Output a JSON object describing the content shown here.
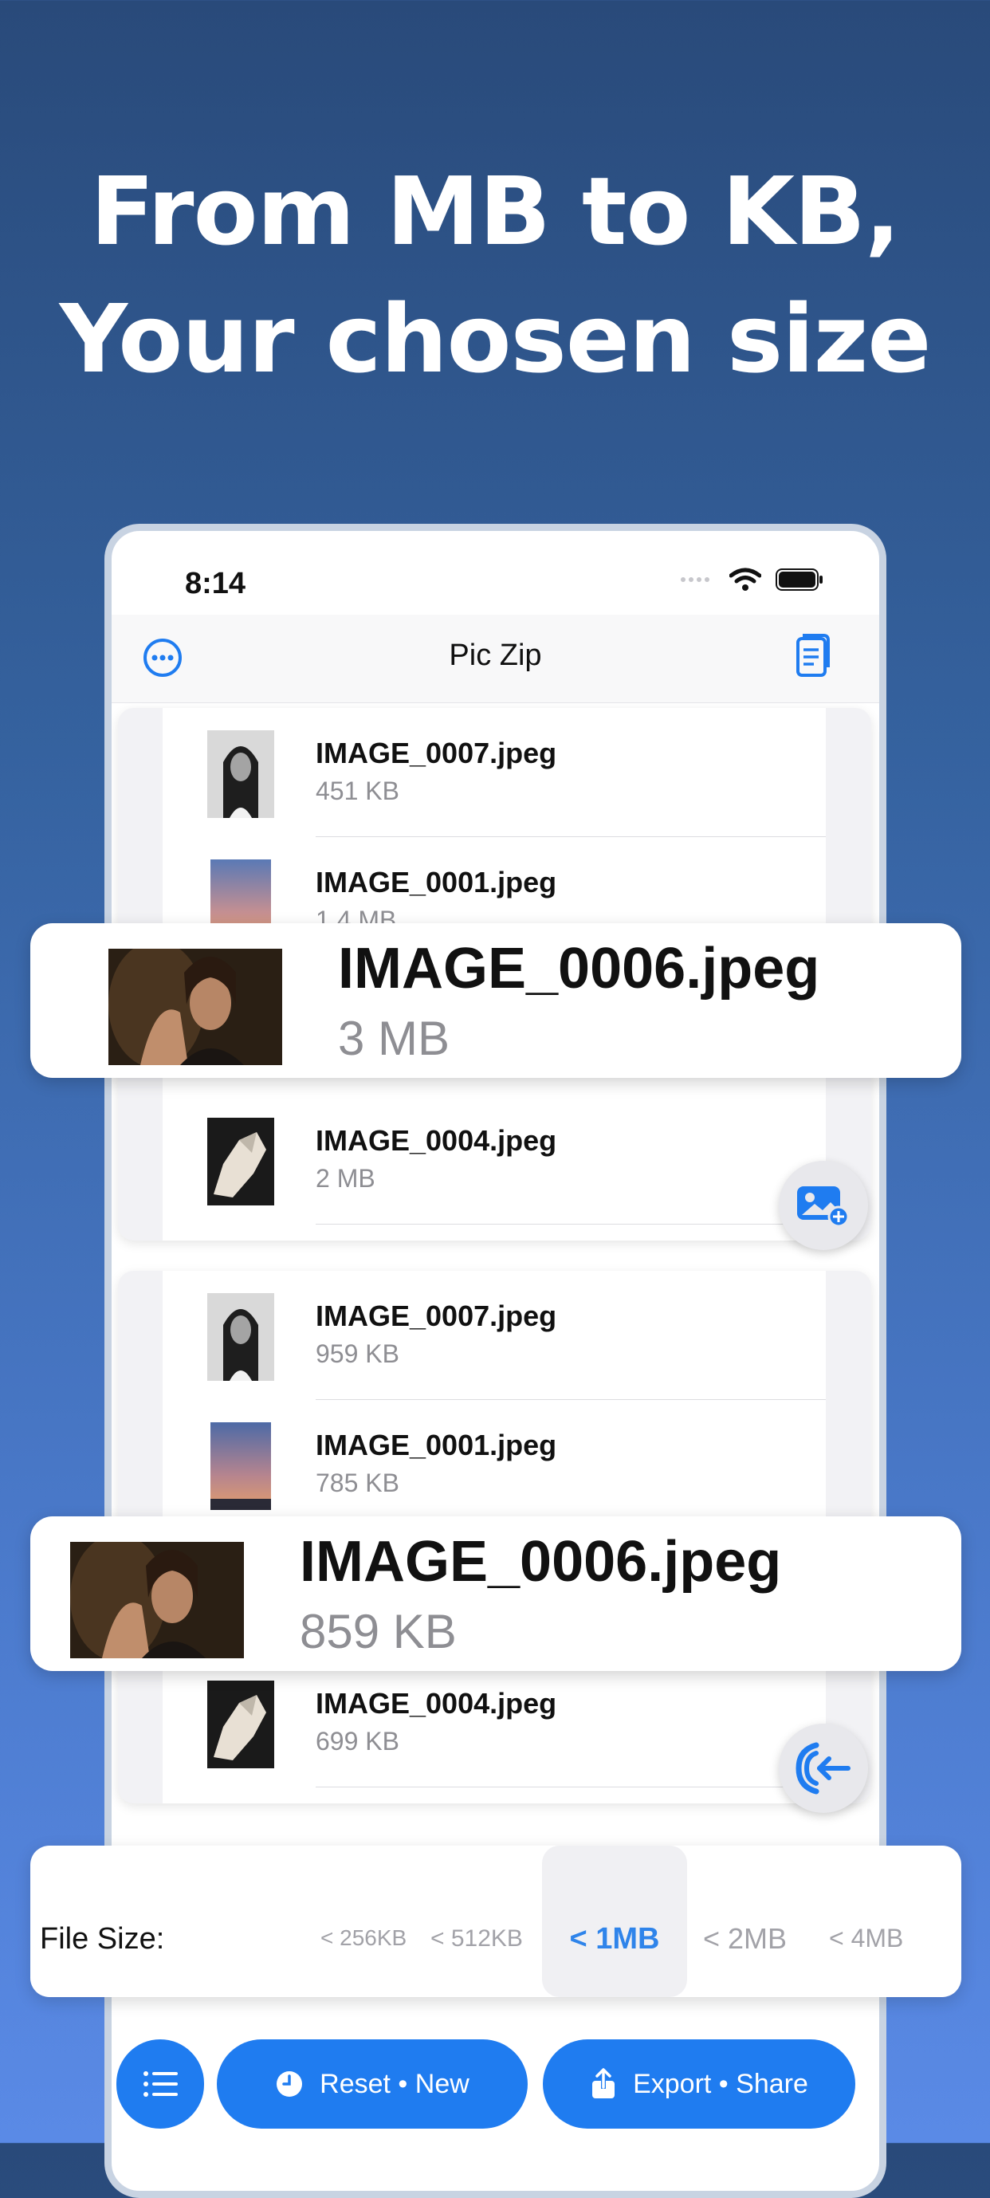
{
  "headline": {
    "line1": "From MB to KB,",
    "line2": "Your chosen size"
  },
  "status_bar": {
    "time": "8:14"
  },
  "nav": {
    "title": "Pic Zip"
  },
  "before_list": [
    {
      "name": "IMAGE_0007.jpeg",
      "size": "451 KB"
    },
    {
      "name": "IMAGE_0001.jpeg",
      "size": "1.4 MB"
    },
    {
      "name": "IMAGE_0004.jpeg",
      "size": "2 MB"
    }
  ],
  "banner_before": {
    "name": "IMAGE_0006.jpeg",
    "size": "3 MB"
  },
  "after_list": [
    {
      "name": "IMAGE_0007.jpeg",
      "size": "959 KB"
    },
    {
      "name": "IMAGE_0001.jpeg",
      "size": "785 KB"
    },
    {
      "name": "IMAGE_0004.jpeg",
      "size": "699 KB"
    }
  ],
  "banner_after": {
    "name": "IMAGE_0006.jpeg",
    "size": "859 KB"
  },
  "file_size": {
    "label": "File Size:",
    "options": [
      "< 256KB",
      "< 512KB",
      "< 1MB",
      "< 2MB",
      "< 4MB"
    ],
    "selected": "< 1MB"
  },
  "bottom_bar": {
    "reset_label": "Reset • New",
    "export_label": "Export • Share"
  },
  "colors": {
    "accent": "#1f7cf0",
    "selected_text": "#2f84ea",
    "secondary_text": "#8e8e93"
  }
}
